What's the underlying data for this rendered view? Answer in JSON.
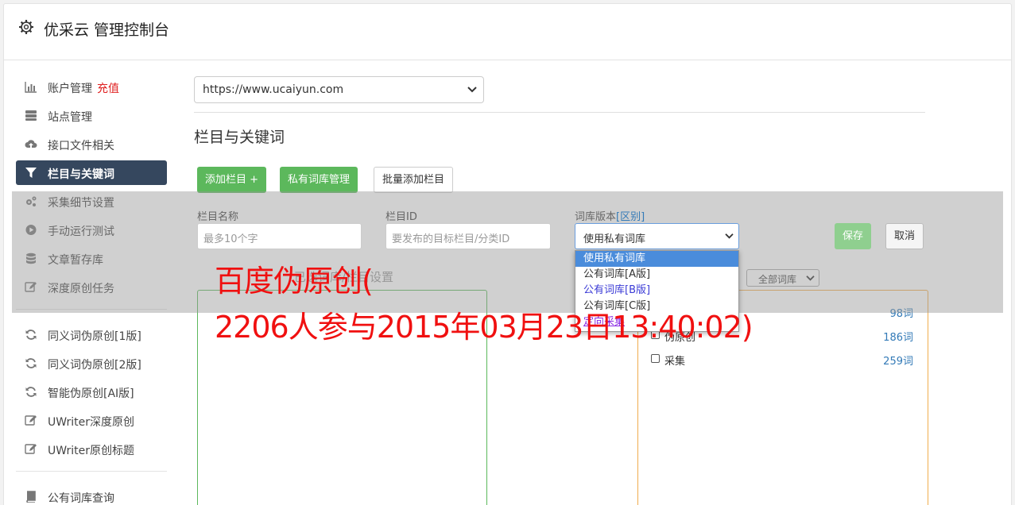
{
  "header": {
    "title": "优采云 管理控制台",
    "icon": "gear-icon"
  },
  "sidebar": {
    "group1": [
      {
        "label": "账户管理",
        "tag": "充值",
        "icon": "bar-chart-icon"
      },
      {
        "label": "站点管理",
        "icon": "server-icon"
      },
      {
        "label": "接口文件相关",
        "icon": "cloud-upload-icon"
      },
      {
        "label": "栏目与关键词",
        "icon": "filter-icon",
        "active": true
      },
      {
        "label": "采集细节设置",
        "icon": "cogs-icon"
      },
      {
        "label": "手动运行测试",
        "icon": "play-circle-icon"
      },
      {
        "label": "文章暂存库",
        "icon": "database-icon"
      },
      {
        "label": "深度原创任务",
        "icon": "edit-icon"
      }
    ],
    "group2": [
      {
        "label": "同义词伪原创[1版]",
        "icon": "refresh-icon"
      },
      {
        "label": "同义词伪原创[2版]",
        "icon": "refresh-icon"
      },
      {
        "label": "智能伪原创[AI版]",
        "icon": "refresh-icon"
      },
      {
        "label": "UWriter深度原创",
        "icon": "edit-icon"
      },
      {
        "label": "UWriter原创标题",
        "icon": "edit-icon"
      }
    ],
    "group3": [
      {
        "label": "公有词库查询",
        "icon": "book-icon"
      }
    ]
  },
  "main": {
    "site_select": "https://www.ucaiyun.com",
    "section_title": "栏目与关键词",
    "buttons": {
      "add_column": "添加栏目 +",
      "private_lib": "私有词库管理",
      "batch_add": "批量添加栏目"
    },
    "form": {
      "name_label": "栏目名称",
      "name_placeholder": "最多10个字",
      "id_label": "栏目ID",
      "id_placeholder": "要发布的目标栏目/分类ID",
      "lib_label": "词库版本",
      "lib_label_link": "[区别]",
      "lib_value": "使用私有词库",
      "save": "保存",
      "cancel": "取消"
    },
    "dropdown_options": [
      "使用私有词库",
      "公有词库[A版]",
      "公有词库[B版]",
      "公有词库[C版]",
      "定向采集"
    ],
    "faded_label": "已选词库/栏目设置",
    "lib_filter": "全部词库",
    "libraries": [
      {
        "name": "",
        "count": "98词"
      },
      {
        "name": "伪原创",
        "count": "186词"
      },
      {
        "name": "采集",
        "count": "259词"
      }
    ]
  },
  "watermark": {
    "line1": "百度伪原创(",
    "line2": "2206人参与2015年03月23日13:40:02)"
  },
  "colors": {
    "green": "#5cb85c",
    "nav_active": "#35475e",
    "orange": "#f0ad4e",
    "red": "#e02020",
    "link": "#337ab7"
  }
}
